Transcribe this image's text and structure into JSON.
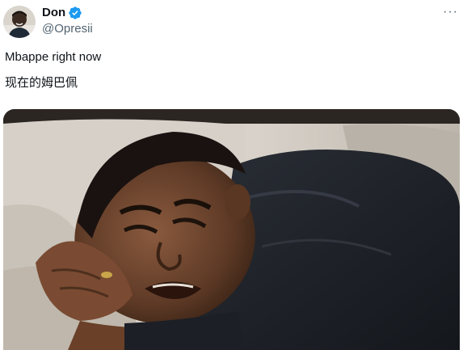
{
  "user": {
    "display_name": "Don",
    "handle": "@Opresii",
    "verified_icon": "verified-badge-icon",
    "avatar_icon": "avatar"
  },
  "tweet": {
    "text_line_1": "Mbappe right now",
    "text_line_2": "现在的姆巴佩"
  },
  "menu": {
    "more_label": "···"
  },
  "colors": {
    "primary_text": "#0f1419",
    "secondary_text": "#536471",
    "verified_blue": "#1d9bf0"
  }
}
